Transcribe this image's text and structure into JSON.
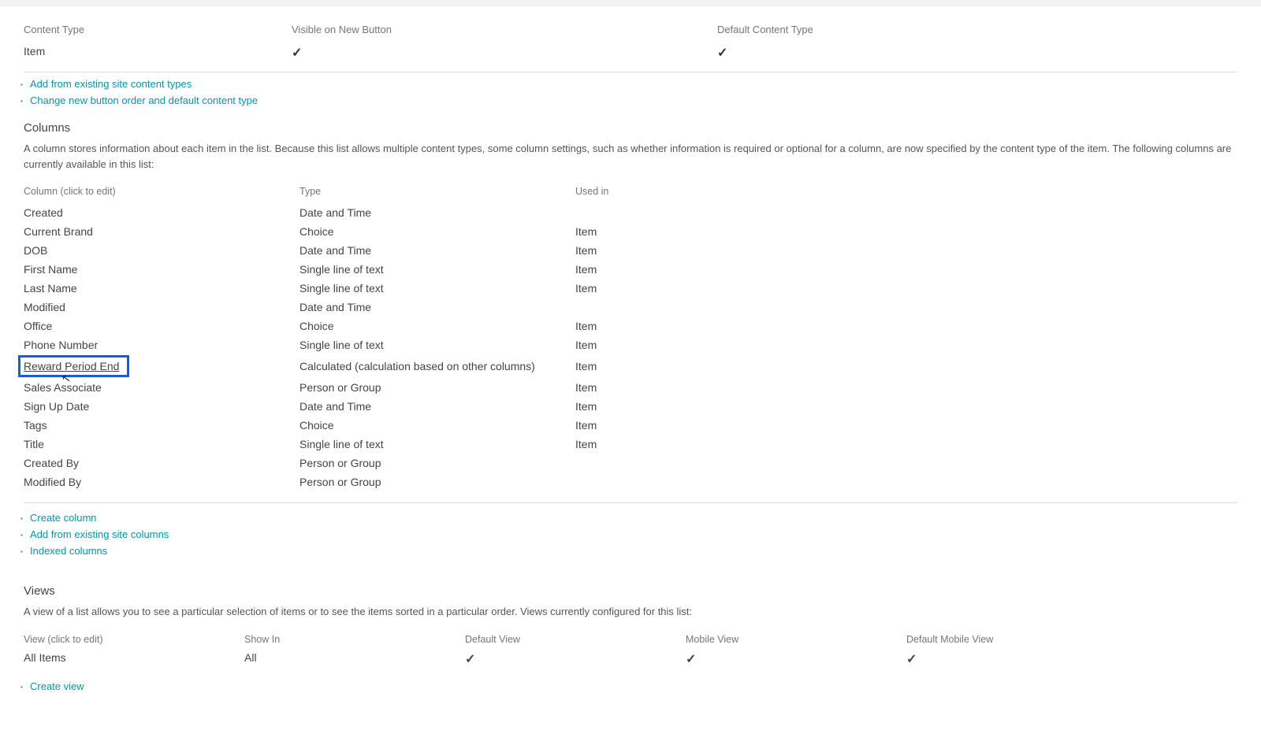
{
  "content_types": {
    "headers": {
      "name": "Content Type",
      "visible": "Visible on New Button",
      "default": "Default Content Type"
    },
    "row": {
      "name": "Item",
      "visible_check": "✓",
      "default_check": "✓"
    },
    "links": {
      "add_existing": "Add from existing site content types",
      "change_order": "Change new button order and default content type"
    }
  },
  "columns_section": {
    "heading": "Columns",
    "desc": "A column stores information about each item in the list. Because this list allows multiple content types, some column settings, such as whether information is required or optional for a column, are now specified by the content type of the item. The following columns are currently available in this list:",
    "headers": {
      "name": "Column (click to edit)",
      "type": "Type",
      "used": "Used in"
    },
    "rows": [
      {
        "name": "Created",
        "type": "Date and Time",
        "used": ""
      },
      {
        "name": "Current Brand",
        "type": "Choice",
        "used": "Item"
      },
      {
        "name": "DOB",
        "type": "Date and Time",
        "used": "Item"
      },
      {
        "name": "First Name",
        "type": "Single line of text",
        "used": "Item"
      },
      {
        "name": "Last Name",
        "type": "Single line of text",
        "used": "Item"
      },
      {
        "name": "Modified",
        "type": "Date and Time",
        "used": ""
      },
      {
        "name": "Office",
        "type": "Choice",
        "used": "Item"
      },
      {
        "name": "Phone Number",
        "type": "Single line of text",
        "used": "Item"
      },
      {
        "name": "Reward Period End",
        "type": "Calculated (calculation based on other columns)",
        "used": "Item",
        "highlight": true
      },
      {
        "name": "Sales Associate",
        "type": "Person or Group",
        "used": "Item"
      },
      {
        "name": "Sign Up Date",
        "type": "Date and Time",
        "used": "Item"
      },
      {
        "name": "Tags",
        "type": "Choice",
        "used": "Item"
      },
      {
        "name": "Title",
        "type": "Single line of text",
        "used": "Item"
      },
      {
        "name": "Created By",
        "type": "Person or Group",
        "used": ""
      },
      {
        "name": "Modified By",
        "type": "Person or Group",
        "used": ""
      }
    ],
    "links": {
      "create_col": "Create column",
      "add_existing_cols": "Add from existing site columns",
      "indexed_cols": "Indexed columns"
    }
  },
  "views_section": {
    "heading": "Views",
    "desc": "A view of a list allows you to see a particular selection of items or to see the items sorted in a particular order. Views currently configured for this list:",
    "headers": {
      "view": "View (click to edit)",
      "show": "Show In",
      "default": "Default View",
      "mobile": "Mobile View",
      "default_mobile": "Default Mobile View"
    },
    "row": {
      "view": "All Items",
      "show": "All",
      "default_check": "✓",
      "mobile_check": "✓",
      "default_mobile_check": "✓"
    },
    "links": {
      "create_view": "Create view"
    }
  }
}
